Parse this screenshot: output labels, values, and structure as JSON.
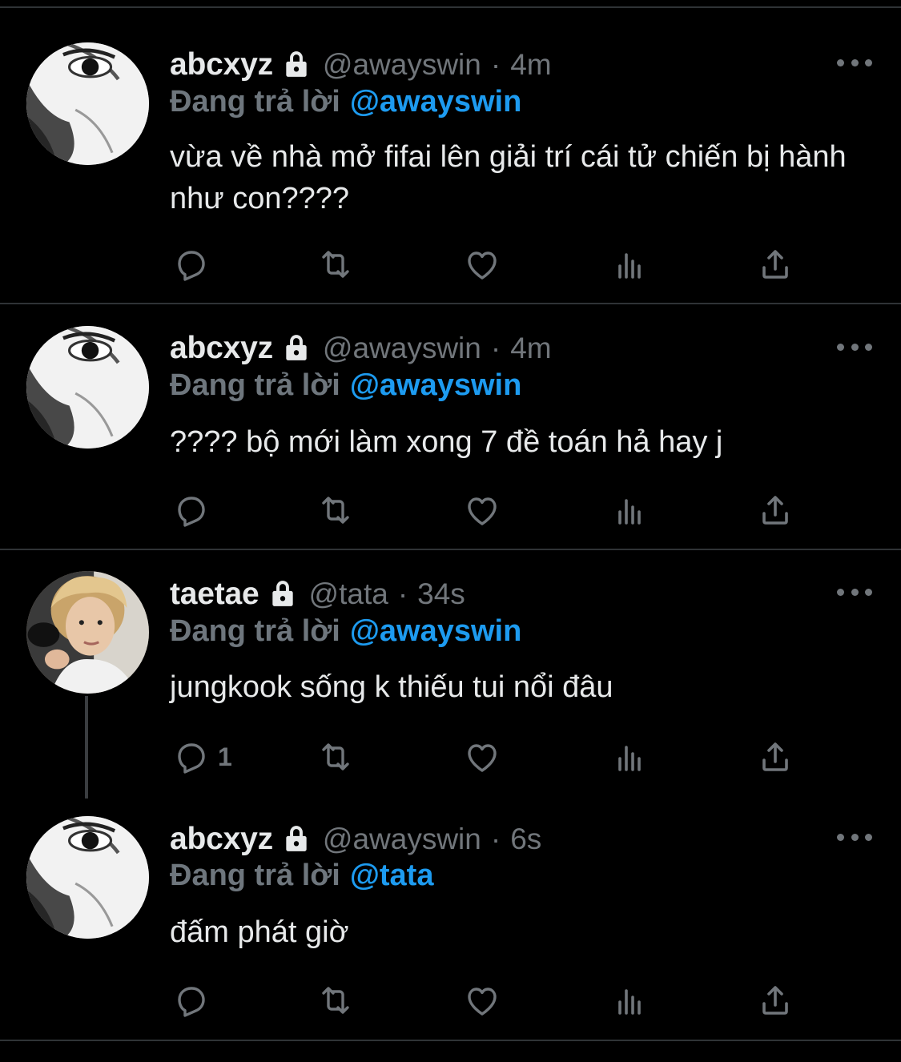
{
  "tweets": [
    {
      "display_name": "abcxyz",
      "handle": "@awayswin",
      "time": "4m",
      "reply_prefix": "Đang trả lời",
      "reply_to": "@awayswin",
      "text": "vừa về nhà mở fifai lên giải trí cái tử chiến bị hành như con????",
      "reply_count": ""
    },
    {
      "display_name": "abcxyz",
      "handle": "@awayswin",
      "time": "4m",
      "reply_prefix": "Đang trả lời",
      "reply_to": "@awayswin",
      "text": "???? bộ mới làm xong 7 đề toán hả hay j",
      "reply_count": ""
    },
    {
      "display_name": "taetae",
      "handle": "@tata",
      "time": "34s",
      "reply_prefix": "Đang trả lời",
      "reply_to": "@awayswin",
      "text": "jungkook sống k thiếu tui nổi đâu",
      "reply_count": "1"
    },
    {
      "display_name": "abcxyz",
      "handle": "@awayswin",
      "time": "6s",
      "reply_prefix": "Đang trả lời",
      "reply_to": "@tata",
      "text": "đấm phát giờ",
      "reply_count": ""
    }
  ],
  "separator": "·",
  "icons": {
    "lock": "lock-icon",
    "more": "more-icon",
    "reply": "reply-icon",
    "retweet": "retweet-icon",
    "like": "heart-icon",
    "analytics": "analytics-icon",
    "share": "share-icon"
  },
  "colors": {
    "background": "#000000",
    "primary_text": "#e7e9ea",
    "secondary_text": "#71767b",
    "link": "#1d9bf0",
    "divider": "#2f3336"
  }
}
